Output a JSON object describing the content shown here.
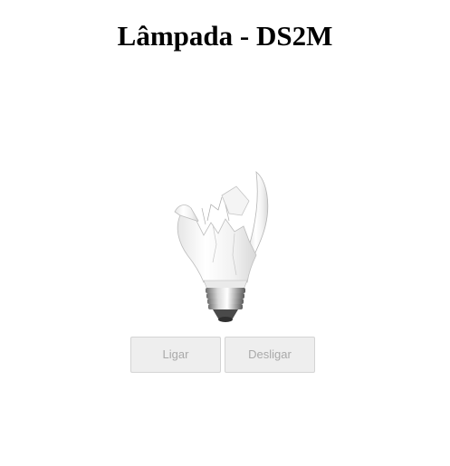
{
  "page": {
    "title": "Lâmpada - DS2M"
  },
  "bulb": {
    "state": "broken",
    "icon": "broken-lightbulb-icon"
  },
  "controls": {
    "on_label": "Ligar",
    "off_label": "Desligar",
    "disabled": true
  },
  "colors": {
    "button_bg": "#eeeeee",
    "button_border": "#d4d4d4",
    "button_text": "#a9a9a9",
    "title": "#000000"
  }
}
